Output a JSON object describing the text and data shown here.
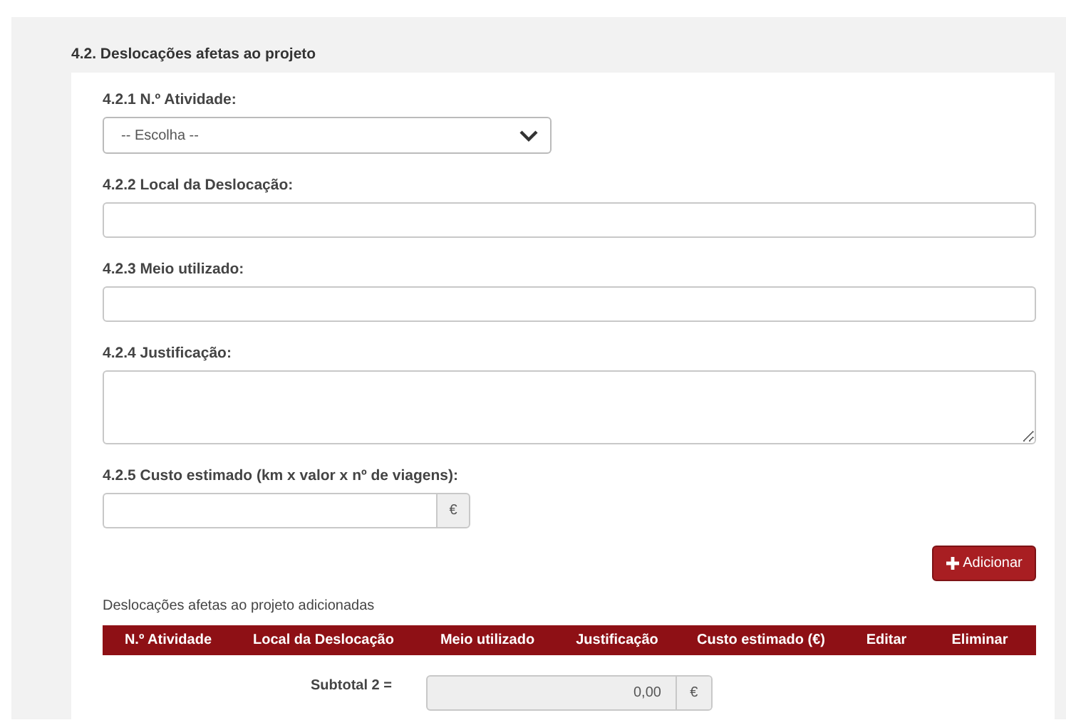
{
  "section_title": "4.2. Deslocações afetas ao projeto",
  "fields": [
    {
      "kind": "select",
      "label": "4.2.1 N.º Atividade:",
      "value": "-- Escolha --"
    },
    {
      "kind": "text",
      "label": "4.2.2 Local da Deslocação:"
    },
    {
      "kind": "text",
      "label": "4.2.3 Meio utilizado:"
    },
    {
      "kind": "textarea",
      "label": "4.2.4 Justificação:"
    },
    {
      "kind": "currency",
      "label": "4.2.5 Custo estimado (km x valor x nº de viagens):",
      "addon": "€"
    }
  ],
  "add_button": "Adicionar",
  "table_caption": "Deslocações afetas ao projeto adicionadas",
  "table": {
    "columns": [
      "N.º Atividade",
      "Local da Deslocação",
      "Meio utilizado",
      "Justificação",
      "Custo estimado (€)",
      "Editar",
      "Eliminar"
    ]
  },
  "subtotal": {
    "label": "Subtotal 2 =",
    "value": "0,00",
    "addon": "€"
  }
}
